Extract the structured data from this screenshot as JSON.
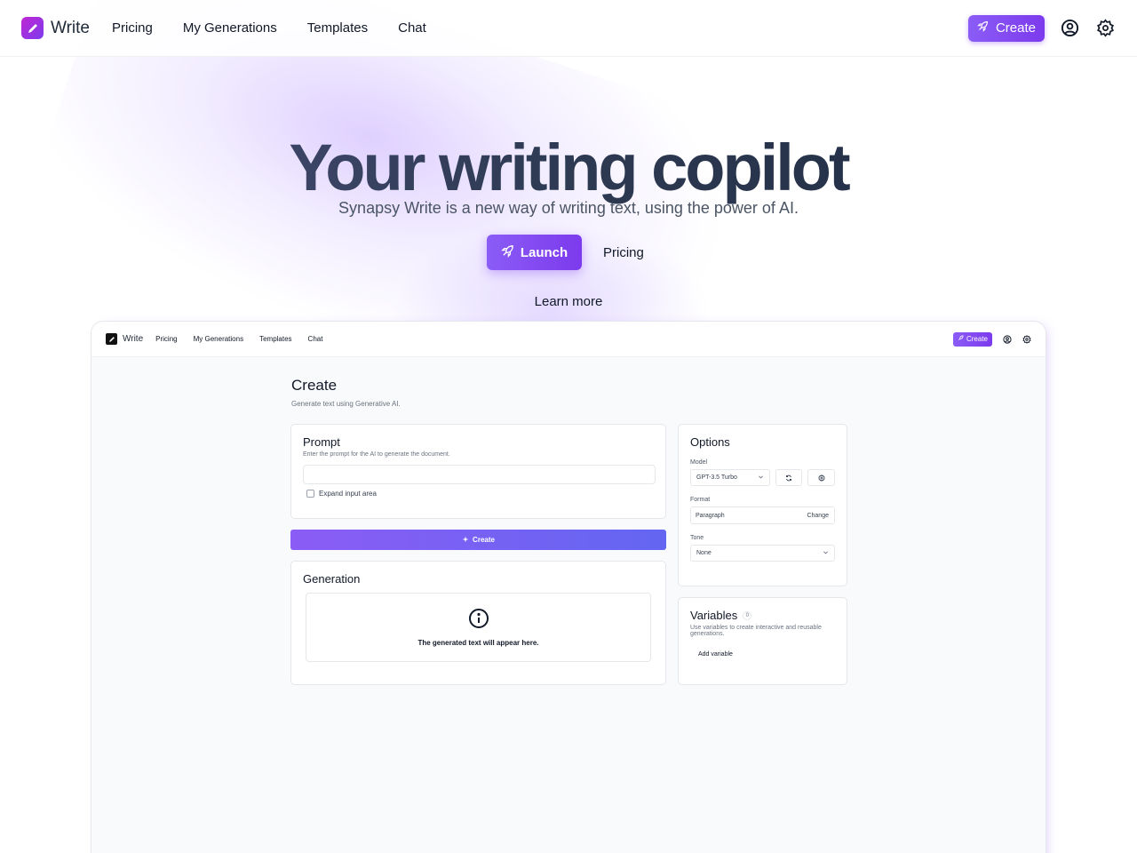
{
  "nav": {
    "brand": "Write",
    "links": [
      "Pricing",
      "My Generations",
      "Templates",
      "Chat"
    ],
    "create_label": "Create",
    "icons": [
      "user-circle-icon",
      "gear-icon"
    ]
  },
  "hero": {
    "title": "Your writing copilot",
    "subtitle": "Synapsy Write is a new way of writing text, using the power of AI.",
    "launch_label": "Launch",
    "pricing_label": "Pricing",
    "learn_more": "Learn more"
  },
  "preview": {
    "nav": {
      "brand": "Write",
      "links": [
        "Pricing",
        "My Generations",
        "Templates",
        "Chat"
      ],
      "create_label": "Create"
    },
    "page": {
      "title": "Create",
      "description": "Generate text using Generative AI."
    },
    "prompt": {
      "title": "Prompt",
      "description": "Enter the prompt for the AI to generate the document.",
      "value": "",
      "expand_label": "Expand input area"
    },
    "create_button": "Create",
    "generation": {
      "title": "Generation",
      "empty_text": "The generated text will appear here."
    },
    "options": {
      "title": "Options",
      "model_label": "Model",
      "model_value": "GPT-3.5 Turbo",
      "format_label": "Format",
      "format_value": "Paragraph",
      "format_change": "Change",
      "tone_label": "Tone",
      "tone_value": "None"
    },
    "variables": {
      "title": "Variables",
      "count": "0",
      "description": "Use variables to create interactive and reusable generations.",
      "add_label": "Add variable"
    }
  },
  "colors": {
    "accent": "#7c3aed",
    "accent_light": "#8b5cf6"
  }
}
